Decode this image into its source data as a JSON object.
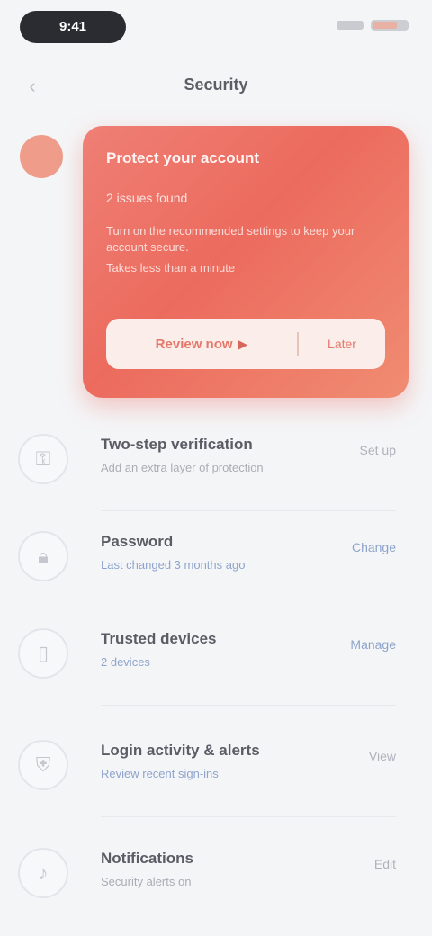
{
  "status_bar": {
    "time": "9:41",
    "battery_level": 0.7
  },
  "header": {
    "title": "Security"
  },
  "promo": {
    "heading": "Protect your account",
    "subheading": "2 issues found",
    "description": "Turn on the recommended settings to keep your account secure.",
    "note": "Takes less than a minute",
    "primary_action": "Review now",
    "secondary_action": "Later"
  },
  "list": {
    "items": [
      {
        "icon": "key-icon",
        "title": "Two-step verification",
        "description": "Add an extra layer of protection",
        "action": "Set up",
        "accent": false
      },
      {
        "icon": "lock-icon",
        "title": "Password",
        "description": "Last changed 3 months ago",
        "action": "Change",
        "accent": true
      },
      {
        "icon": "phone-icon",
        "title": "Trusted devices",
        "description": "2 devices",
        "action": "Manage",
        "accent": true
      },
      {
        "icon": "shield-icon",
        "title": "Login activity & alerts",
        "description": "Review recent sign-ins",
        "action": "View",
        "accent": false
      },
      {
        "icon": "bell-icon",
        "title": "Notifications",
        "description": "Security alerts on",
        "action": "Edit",
        "accent": false
      }
    ]
  }
}
